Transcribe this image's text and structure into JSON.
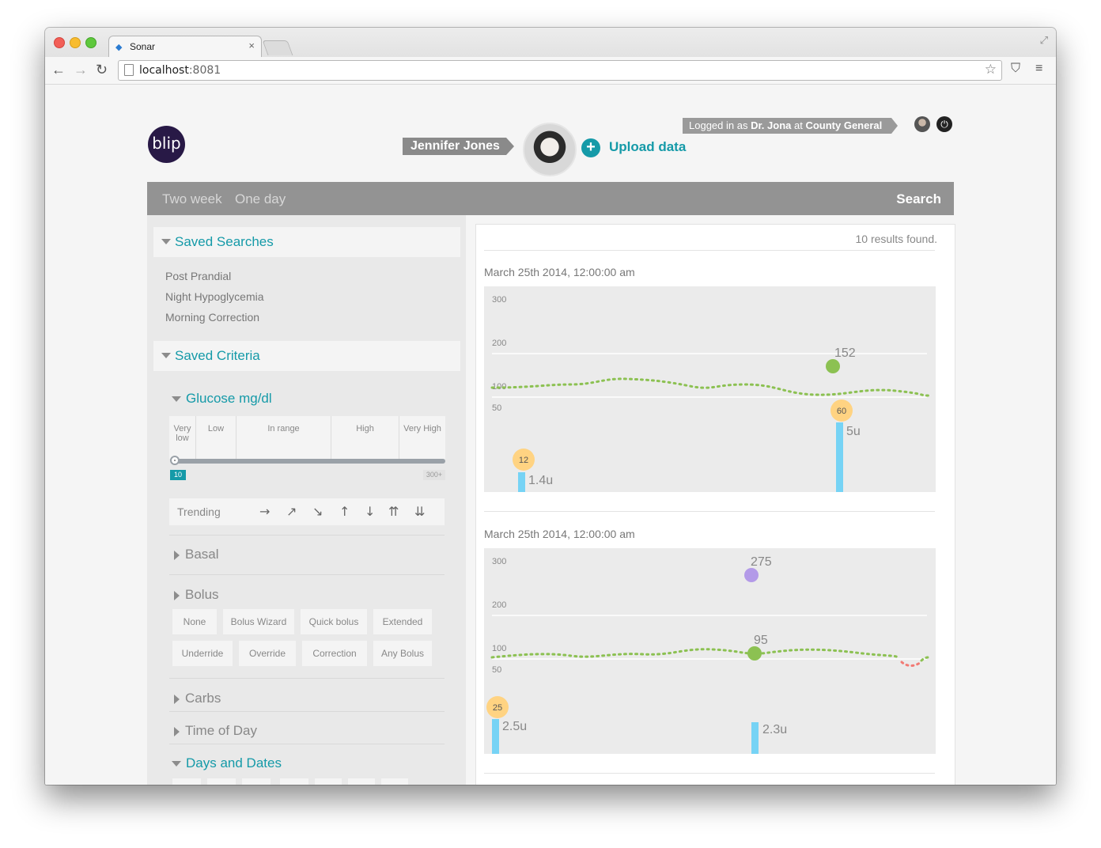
{
  "browser": {
    "tab_title": "Sonar",
    "url_host": "localhost",
    "url_port": ":8081"
  },
  "header": {
    "logo_text": "blip",
    "logged_in_prefix": "Logged in as ",
    "logged_in_user": "Dr. Jona",
    "logged_in_mid": " at ",
    "logged_in_org": "County General",
    "patient_name": "Jennifer Jones",
    "upload_label": "Upload data"
  },
  "nav": {
    "tab_two_week": "Two week",
    "tab_one_day": "One day",
    "search_label": "Search"
  },
  "sidebar": {
    "saved_searches_title": "Saved Searches",
    "saved_searches": [
      "Post Prandial",
      "Night Hypoglycemia",
      "Morning Correction"
    ],
    "saved_criteria_title": "Saved Criteria",
    "glucose_title": "Glucose mg/dl",
    "ranges": [
      "Very low",
      "Low",
      "In range",
      "High",
      "Very High"
    ],
    "slider_value": "10",
    "slider_max": "300+",
    "trending_label": "Trending",
    "trending_arrows": [
      "→",
      "↗",
      "↘",
      "↑",
      "↓",
      "⇈",
      "⇊"
    ],
    "basal_label": "Basal",
    "bolus_label": "Bolus",
    "bolus_options_row1": [
      "None",
      "Bolus Wizard",
      "Quick bolus",
      "Extended"
    ],
    "bolus_options_row2": [
      "Underride",
      "Override",
      "Correction",
      "Any Bolus"
    ],
    "carbs_label": "Carbs",
    "time_of_day_label": "Time of Day",
    "days_dates_label": "Days and Dates"
  },
  "results": {
    "count_label": "10 results found.",
    "items": [
      {
        "date": "March 25th 2014, 12:00:00 am",
        "chart_data": {
          "type": "line",
          "y_ticks": [
            "300",
            "200",
            "100",
            "50"
          ],
          "cbg_line_value": 100,
          "bg_points": [
            {
              "label": "152",
              "value": 152,
              "color": "#8cc152"
            }
          ],
          "carbs": [
            {
              "label": "12"
            },
            {
              "label": "60"
            }
          ],
          "boluses": [
            {
              "label": "1.4u"
            },
            {
              "label": "5u"
            }
          ]
        }
      },
      {
        "date": "March 25th 2014, 12:00:00 am",
        "chart_data": {
          "type": "line",
          "y_ticks": [
            "300",
            "200",
            "100",
            "50"
          ],
          "cbg_line_value": 100,
          "bg_points": [
            {
              "label": "275",
              "value": 275,
              "color": "#b39ae8"
            },
            {
              "label": "95",
              "value": 95,
              "color": "#8cc152"
            }
          ],
          "carbs": [
            {
              "label": "25"
            }
          ],
          "boluses": [
            {
              "label": "2.5u"
            },
            {
              "label": "2.3u"
            }
          ]
        }
      }
    ]
  }
}
